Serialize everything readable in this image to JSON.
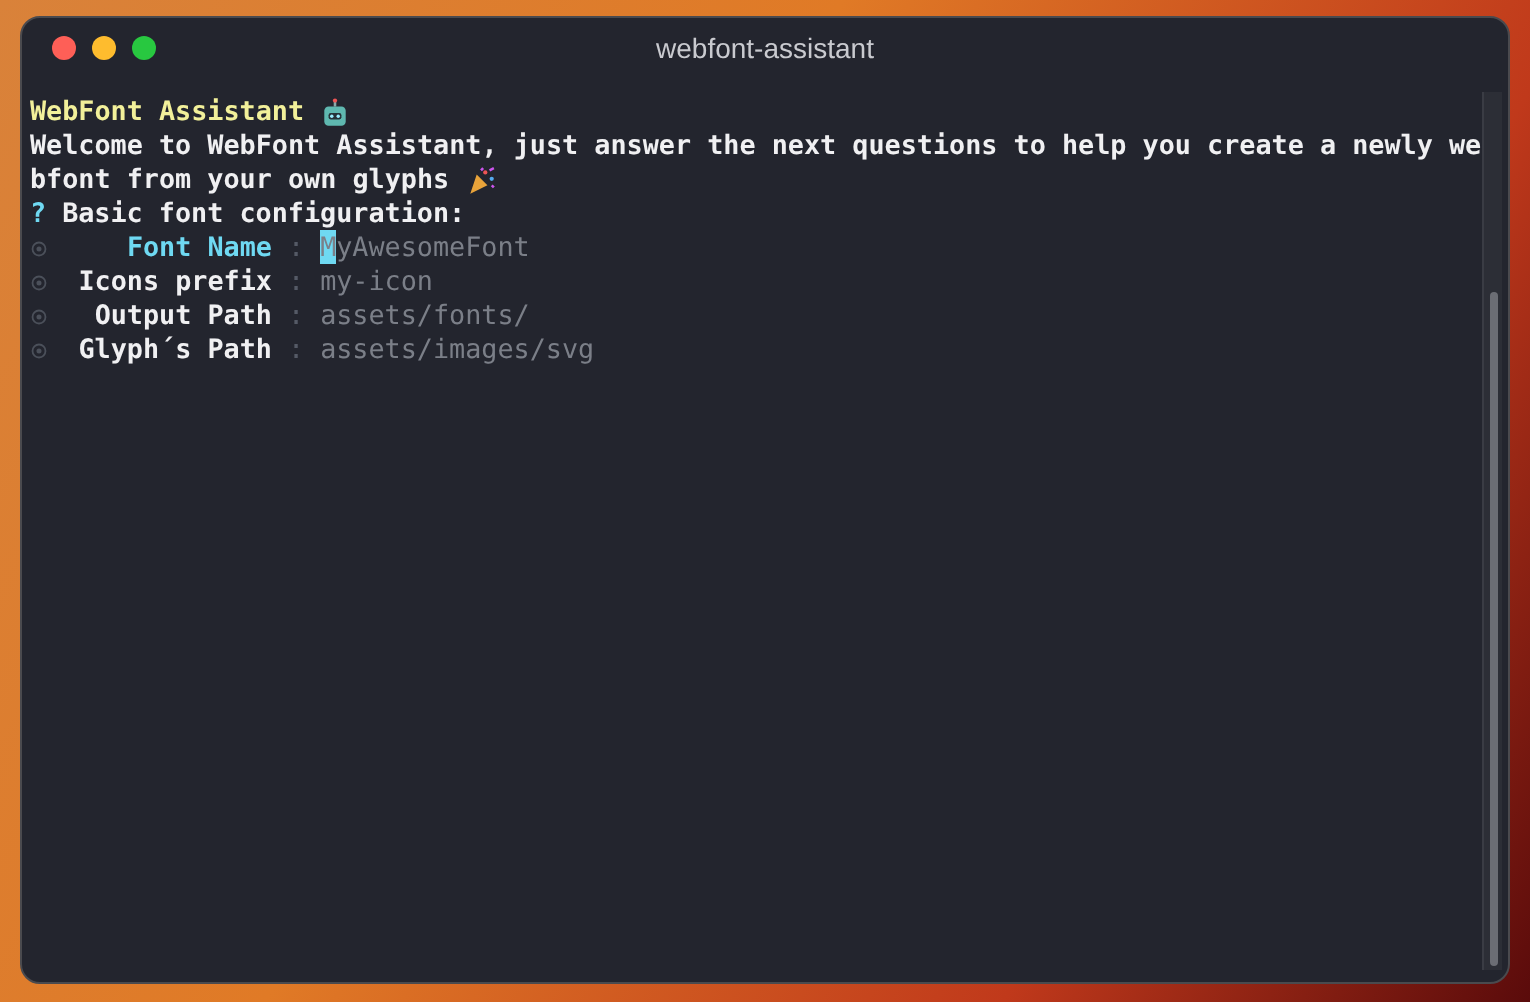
{
  "window": {
    "title": "webfont-assistant"
  },
  "terminal": {
    "heading": "WebFont Assistant",
    "welcome_lines": [
      "Welcome to WebFont Assistant, just answer the next questions to help you create a newly we",
      "bfont from your own glyphs"
    ],
    "prompt_mark": "?",
    "prompt": "Basic font configuration:",
    "fields": [
      {
        "label": "Font Name",
        "separator": ":",
        "value": "MyAwesomeFont",
        "selected": true
      },
      {
        "label": "Icons prefix",
        "separator": ":",
        "value": "my-icon",
        "selected": false
      },
      {
        "label": "Output Path",
        "separator": ":",
        "value": "assets/fonts/",
        "selected": false
      },
      {
        "label": "Glyph´s Path",
        "separator": ":",
        "value": "assets/images/svg",
        "selected": false
      }
    ]
  }
}
